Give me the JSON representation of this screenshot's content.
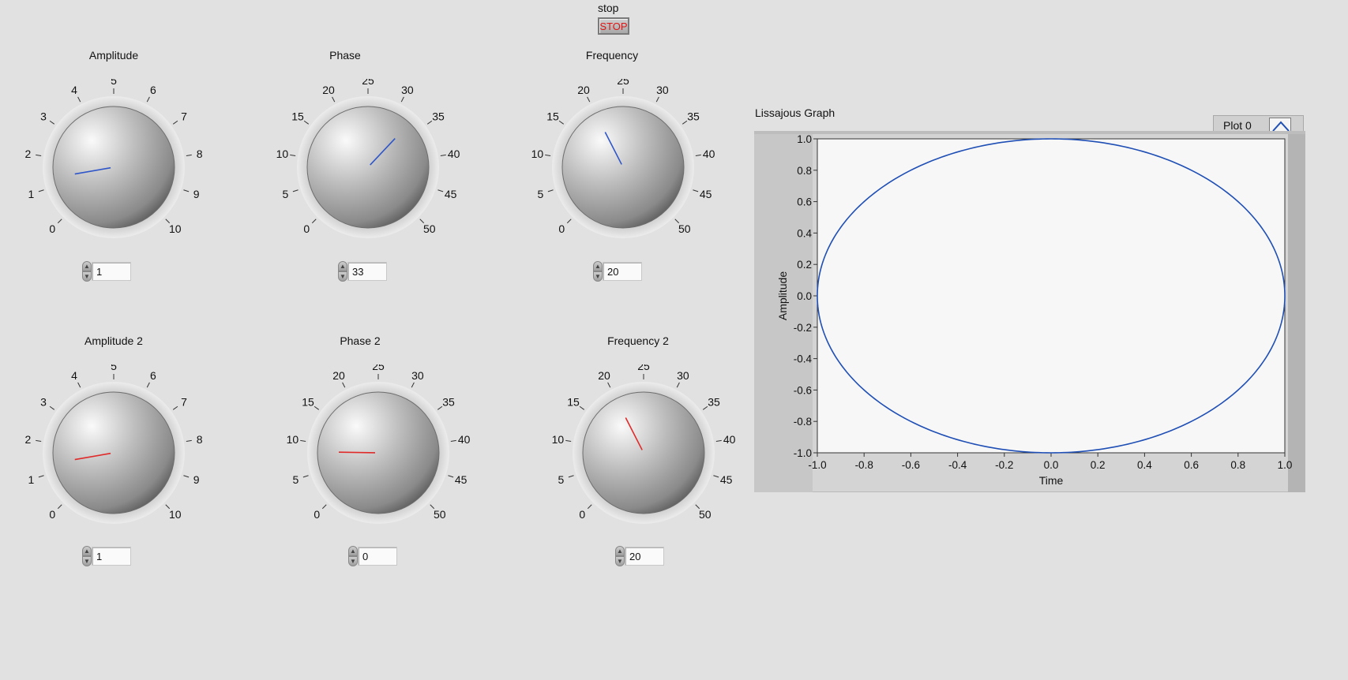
{
  "stop": {
    "label": "stop",
    "button_text": "STOP"
  },
  "knobs": [
    {
      "title": "Amplitude",
      "value": "1",
      "needle_color": "#2f56c9",
      "range": [
        0,
        10
      ],
      "tick_labels": [
        "0",
        "1",
        "2",
        "3",
        "4",
        "5",
        "6",
        "7",
        "8",
        "9",
        "10"
      ],
      "reading": 1.3
    },
    {
      "title": "Phase",
      "value": "33",
      "needle_color": "#2f56c9",
      "range": [
        0,
        50
      ],
      "tick_labels": [
        "0",
        "5",
        "10",
        "15",
        "20",
        "25",
        "30",
        "35",
        "40",
        "45",
        "50"
      ],
      "reading": 33
    },
    {
      "title": "Frequency",
      "value": "20",
      "needle_color": "#2f56c9",
      "range": [
        0,
        50
      ],
      "tick_labels": [
        "0",
        "5",
        "10",
        "15",
        "20",
        "25",
        "30",
        "35",
        "40",
        "45",
        "50"
      ],
      "reading": 20
    },
    {
      "title": "Amplitude 2",
      "value": "1",
      "needle_color": "#e02a2a",
      "range": [
        0,
        10
      ],
      "tick_labels": [
        "0",
        "1",
        "2",
        "3",
        "4",
        "5",
        "6",
        "7",
        "8",
        "9",
        "10"
      ],
      "reading": 1.3
    },
    {
      "title": "Phase 2",
      "value": "0",
      "needle_color": "#e02a2a",
      "range": [
        0,
        50
      ],
      "tick_labels": [
        "0",
        "5",
        "10",
        "15",
        "20",
        "25",
        "30",
        "35",
        "40",
        "45",
        "50"
      ],
      "reading": 8.5
    },
    {
      "title": "Frequency 2",
      "value": "20",
      "needle_color": "#e02a2a",
      "range": [
        0,
        50
      ],
      "tick_labels": [
        "0",
        "5",
        "10",
        "15",
        "20",
        "25",
        "30",
        "35",
        "40",
        "45",
        "50"
      ],
      "reading": 20
    }
  ],
  "graph": {
    "title": "Lissajous Graph",
    "legend_label": "Plot 0"
  },
  "chart_data": {
    "type": "line",
    "title": "Lissajous Graph",
    "xlabel": "Time",
    "ylabel": "Amplitude",
    "xlim": [
      -1.0,
      1.0
    ],
    "ylim": [
      -1.0,
      1.0
    ],
    "x_ticks": [
      "-1.0",
      "-0.8",
      "-0.6",
      "-0.4",
      "-0.2",
      "0.0",
      "0.2",
      "0.4",
      "0.6",
      "0.8",
      "1.0"
    ],
    "y_ticks": [
      "-1.0",
      "-0.8",
      "-0.6",
      "-0.4",
      "-0.2",
      "0.0",
      "0.2",
      "0.4",
      "0.6",
      "0.8",
      "1.0"
    ],
    "series": [
      {
        "name": "Plot 0",
        "color": "#1f4fb5",
        "shape": "ellipse",
        "x_amplitude": 1.0,
        "y_amplitude": 1.0,
        "phase_deg": 90
      }
    ],
    "grid": false,
    "legend": "top-right"
  }
}
